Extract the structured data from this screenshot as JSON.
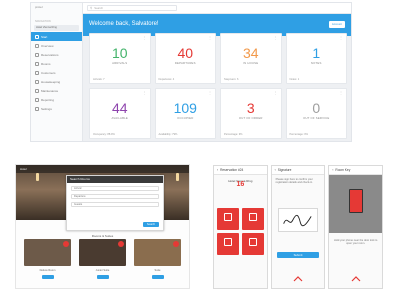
{
  "dashboard": {
    "brand": "Gas",
    "brand_sub": "protel",
    "search_placeholder": "Search",
    "banner_title": "Welcome back, Salvatore!",
    "banner_button": "Account",
    "sidebar_section": "NAVIGATION",
    "sidebar_user": "Hotel Vienna Ring",
    "sidebar_items": [
      {
        "label": "Start"
      },
      {
        "label": "Overview"
      },
      {
        "label": "Reservations"
      },
      {
        "label": "Rooms"
      },
      {
        "label": "Customers"
      },
      {
        "label": "Housekeeping"
      },
      {
        "label": "Maintenance"
      },
      {
        "label": "Reporting"
      },
      {
        "label": "Settings"
      }
    ],
    "cards": [
      {
        "value": "10",
        "label": "ARRIVALS",
        "foot": "Arrivals: 7",
        "color": "#43b36a"
      },
      {
        "value": "40",
        "label": "DEPARTURES",
        "foot": "Departures: 4",
        "color": "#e53935"
      },
      {
        "value": "34",
        "label": "IN HOUSE",
        "foot": "Stayovers: 6",
        "color": "#f2994a"
      },
      {
        "value": "1",
        "label": "NOTES",
        "foot": "Notes: 1",
        "color": "#2f9fe4"
      },
      {
        "value": "44",
        "label": "AVAILABLE",
        "foot": "Occupancy: 88.9%",
        "color": "#8e44ad"
      },
      {
        "value": "109",
        "label": "OCCUPIED",
        "foot": "Availability: 79%",
        "color": "#2f9fe4"
      },
      {
        "value": "3",
        "label": "OUT OF ORDER",
        "foot": "Percentage: 3%",
        "color": "#e53935"
      },
      {
        "value": "0",
        "label": "OUT OF SERVICE",
        "foot": "Percentage: 0%",
        "color": "#9e9e9e"
      }
    ]
  },
  "web": {
    "topnav": "Hotel",
    "modal_title": "Search Rooms",
    "modal_rows": [
      "Arrival",
      "Departure",
      "Guests"
    ],
    "modal_button": "Search",
    "section_title": "Rooms & Suites",
    "thumbs": [
      {
        "caption": "Deluxe Room",
        "color": "#6d5a49"
      },
      {
        "caption": "Junior Suite",
        "color": "#4a3b30"
      },
      {
        "caption": "Suite",
        "color": "#8a6d4e"
      }
    ]
  },
  "mobile": {
    "phone1_title": "Reservation #24",
    "phone1_hotel": "Hotel Vienna Ring",
    "phone1_date": "16",
    "phone2_title": "Signature",
    "phone2_text": "Please sign here to confirm your registration details and check-in.",
    "phone2_button": "Submit",
    "phone3_title": "Room Key",
    "phone3_text": "Hold your phone near the door lock to open your room."
  },
  "colors": {
    "accent": "#2f9fe4",
    "brand_red": "#e53935"
  }
}
